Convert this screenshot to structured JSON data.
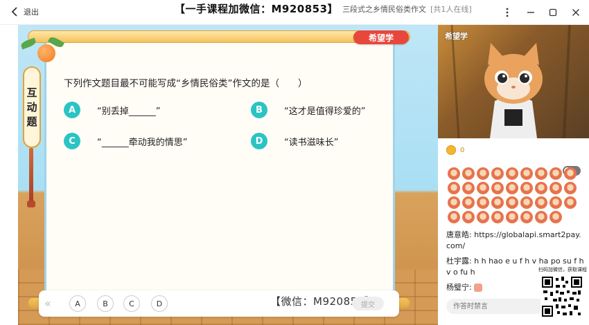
{
  "topbar": {
    "back_label": "退出",
    "watermark": "【一手课程加微信：M920853】",
    "lesson_title": "三段式之乡情民俗类作文",
    "online": "[共1人在线]"
  },
  "stage": {
    "brand": "希望学",
    "tag_chars": [
      "互",
      "动",
      "题"
    ],
    "question": "下列作文题目最不可能写成“乡情民俗类”作文的是（　　）",
    "options": [
      {
        "letter": "A",
        "text": "“别丢掉______”"
      },
      {
        "letter": "B",
        "text": "“这才是值得珍爱的”"
      },
      {
        "letter": "C",
        "text": "“______牵动我的情思”"
      },
      {
        "letter": "D",
        "text": "“读书滋味长”"
      }
    ]
  },
  "answer_bar": {
    "buttons": [
      "A",
      "B",
      "C",
      "D"
    ],
    "watermark": "【微信：M920853】",
    "submit_label": "提交"
  },
  "sidebar": {
    "video_logo": "希望学",
    "coin_count": "0",
    "chat": [
      {
        "name": "唐意皓:",
        "text": "https://globalapi.smart2pay.com/"
      },
      {
        "name": "杜宇露:",
        "text": "h h hao e u f h v ha po su f h v o fu h"
      },
      {
        "name": "杨璧宁:",
        "text": ""
      }
    ],
    "chat_input_placeholder": "作答时禁言",
    "qr_caption": "扫码加微信，获取课程"
  },
  "colors": {
    "accent": "#2bc4c4",
    "brand_red": "#e8473b"
  }
}
